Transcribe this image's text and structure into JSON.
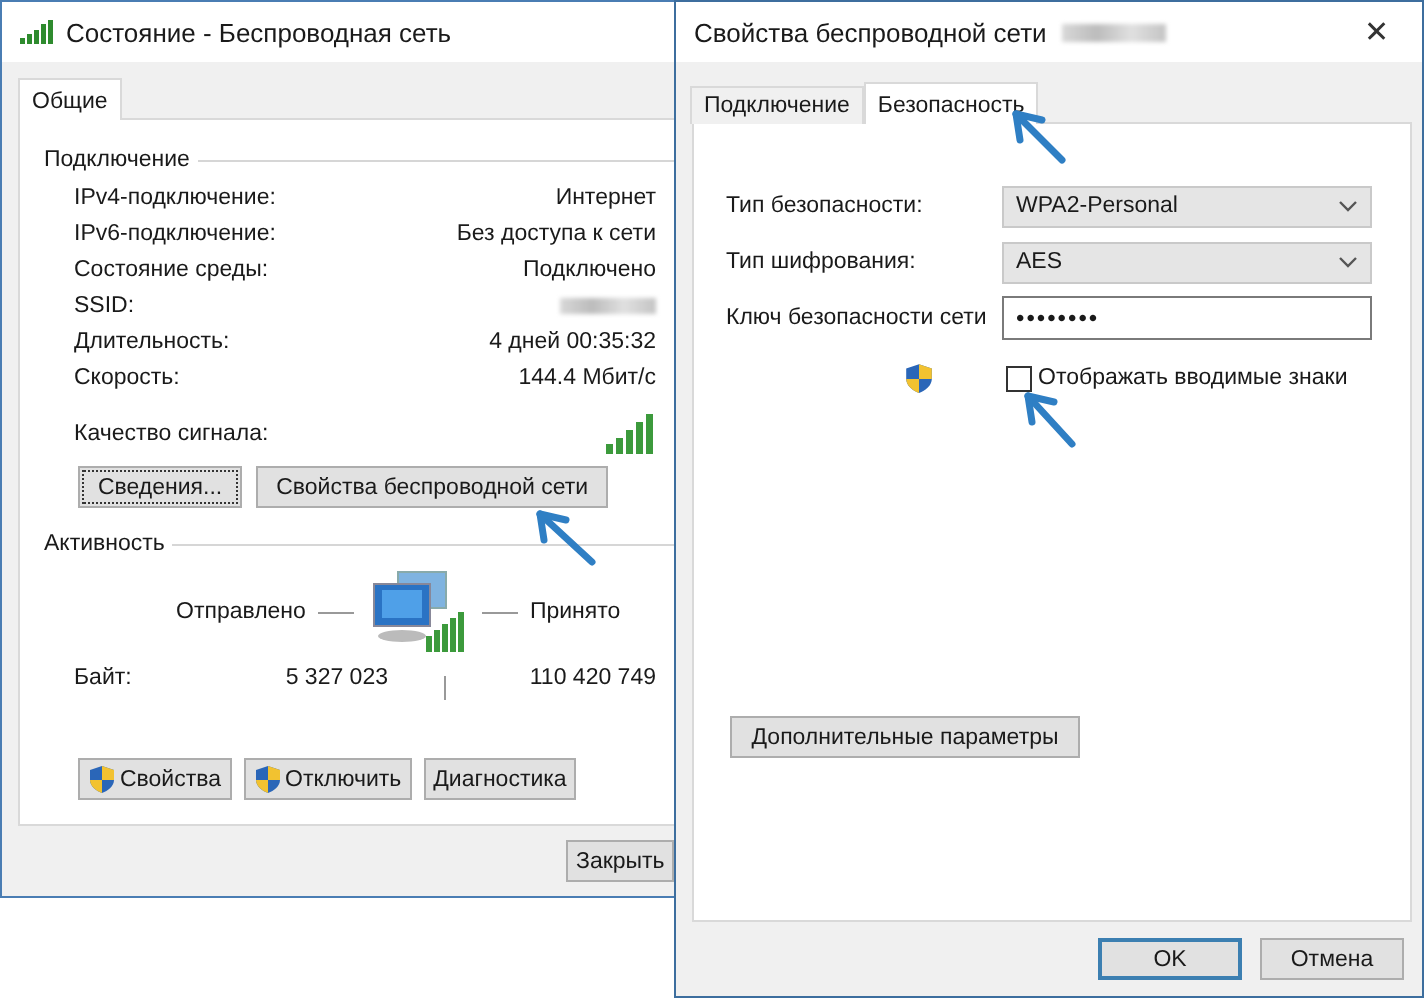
{
  "status_window": {
    "title": "Состояние - Беспроводная сеть",
    "tabs": [
      {
        "label": "Общие",
        "selected": true
      }
    ],
    "connection": {
      "heading": "Подключение",
      "rows": [
        {
          "label": "IPv4-подключение:",
          "value": "Интернет",
          "redacted": false
        },
        {
          "label": "IPv6-подключение:",
          "value": "Без доступа к сети",
          "redacted": false
        },
        {
          "label": "Состояние среды:",
          "value": "Подключено",
          "redacted": false
        },
        {
          "label": "SSID:",
          "redacted": true
        },
        {
          "label": "Длительность:",
          "value": "4 дней 00:35:32",
          "redacted": false
        },
        {
          "label": "Скорость:",
          "value": "144.4 Мбит/с",
          "redacted": false
        }
      ],
      "signal_label": "Качество сигнала:",
      "buttons": [
        {
          "label": "Сведения...",
          "focused": true
        },
        {
          "label": "Свойства беспроводной сети",
          "focused": false
        }
      ]
    },
    "activity": {
      "heading": "Активность",
      "sent_label": "Отправлено",
      "received_label": "Принято",
      "bytes_label": "Байт:",
      "bytes_sent": "5 327 023",
      "bytes_received": "110 420 749"
    },
    "action_buttons": [
      {
        "label": "Свойства",
        "shield": true
      },
      {
        "label": "Отключить",
        "shield": true
      },
      {
        "label": "Диагностика",
        "shield": false
      }
    ],
    "close_button": "Закрыть"
  },
  "properties_window": {
    "title": "Свойства беспроводной сети",
    "title_redacted": true,
    "close_glyph": "✕",
    "tabs": [
      {
        "label": "Подключение",
        "selected": false
      },
      {
        "label": "Безопасность",
        "selected": true
      }
    ],
    "fields": [
      {
        "kind": "select",
        "label": "Тип безопасности:",
        "value": "WPA2-Personal"
      },
      {
        "kind": "select",
        "label": "Тип шифрования:",
        "value": "AES"
      },
      {
        "kind": "password",
        "label": "Ключ безопасности сети",
        "value": "••••••••"
      }
    ],
    "show_characters": {
      "label": "Отображать вводимые знаки",
      "checked": false
    },
    "advanced_button": "Дополнительные параметры",
    "buttons": [
      {
        "label": "OK",
        "default": true
      },
      {
        "label": "Отмена",
        "default": false
      }
    ]
  }
}
